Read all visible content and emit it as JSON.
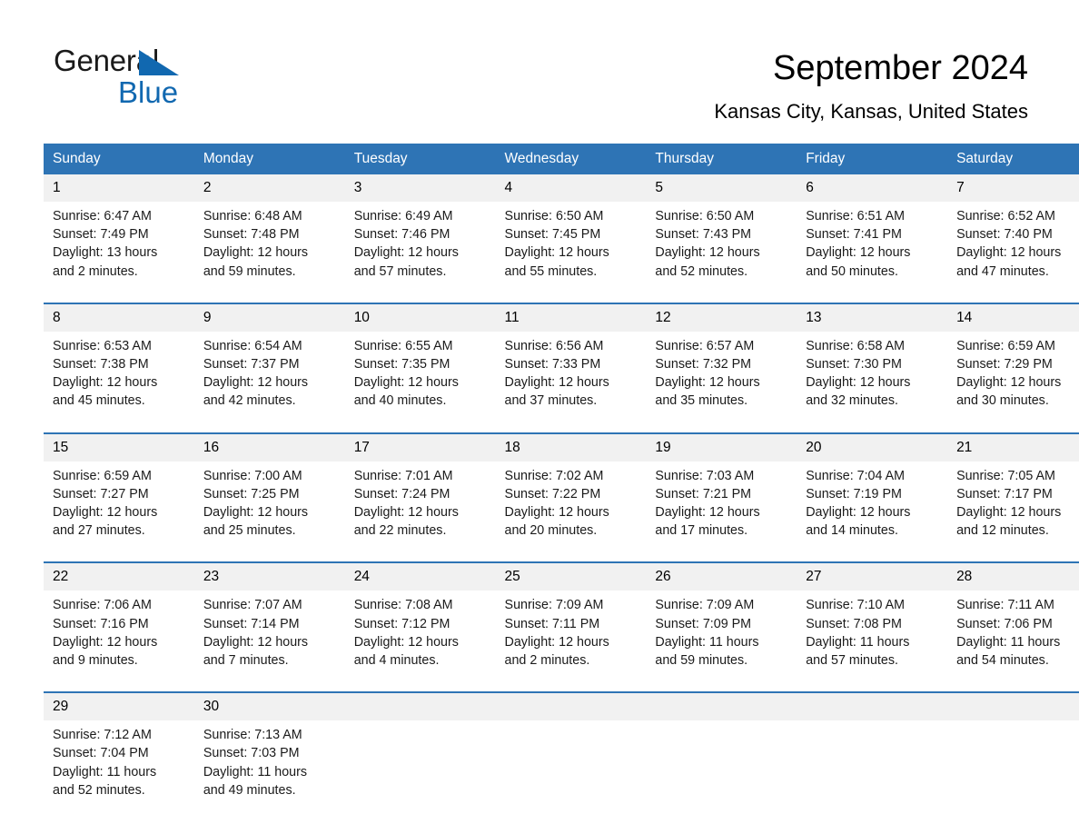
{
  "brand": {
    "line1": "General",
    "line2": "Blue",
    "accent_color": "#1168b0"
  },
  "header": {
    "title": "September 2024",
    "subtitle": "Kansas City, Kansas, United States"
  },
  "theme": {
    "header_blue": "#2e74b5",
    "daynum_band": "#f1f1f1",
    "text": "#1a1a1a"
  },
  "weekday_headers": [
    "Sunday",
    "Monday",
    "Tuesday",
    "Wednesday",
    "Thursday",
    "Friday",
    "Saturday"
  ],
  "weeks": [
    {
      "days": [
        {
          "num": "1",
          "sunrise": "Sunrise: 6:47 AM",
          "sunset": "Sunset: 7:49 PM",
          "daylight_1": "Daylight: 13 hours",
          "daylight_2": "and 2 minutes."
        },
        {
          "num": "2",
          "sunrise": "Sunrise: 6:48 AM",
          "sunset": "Sunset: 7:48 PM",
          "daylight_1": "Daylight: 12 hours",
          "daylight_2": "and 59 minutes."
        },
        {
          "num": "3",
          "sunrise": "Sunrise: 6:49 AM",
          "sunset": "Sunset: 7:46 PM",
          "daylight_1": "Daylight: 12 hours",
          "daylight_2": "and 57 minutes."
        },
        {
          "num": "4",
          "sunrise": "Sunrise: 6:50 AM",
          "sunset": "Sunset: 7:45 PM",
          "daylight_1": "Daylight: 12 hours",
          "daylight_2": "and 55 minutes."
        },
        {
          "num": "5",
          "sunrise": "Sunrise: 6:50 AM",
          "sunset": "Sunset: 7:43 PM",
          "daylight_1": "Daylight: 12 hours",
          "daylight_2": "and 52 minutes."
        },
        {
          "num": "6",
          "sunrise": "Sunrise: 6:51 AM",
          "sunset": "Sunset: 7:41 PM",
          "daylight_1": "Daylight: 12 hours",
          "daylight_2": "and 50 minutes."
        },
        {
          "num": "7",
          "sunrise": "Sunrise: 6:52 AM",
          "sunset": "Sunset: 7:40 PM",
          "daylight_1": "Daylight: 12 hours",
          "daylight_2": "and 47 minutes."
        }
      ]
    },
    {
      "days": [
        {
          "num": "8",
          "sunrise": "Sunrise: 6:53 AM",
          "sunset": "Sunset: 7:38 PM",
          "daylight_1": "Daylight: 12 hours",
          "daylight_2": "and 45 minutes."
        },
        {
          "num": "9",
          "sunrise": "Sunrise: 6:54 AM",
          "sunset": "Sunset: 7:37 PM",
          "daylight_1": "Daylight: 12 hours",
          "daylight_2": "and 42 minutes."
        },
        {
          "num": "10",
          "sunrise": "Sunrise: 6:55 AM",
          "sunset": "Sunset: 7:35 PM",
          "daylight_1": "Daylight: 12 hours",
          "daylight_2": "and 40 minutes."
        },
        {
          "num": "11",
          "sunrise": "Sunrise: 6:56 AM",
          "sunset": "Sunset: 7:33 PM",
          "daylight_1": "Daylight: 12 hours",
          "daylight_2": "and 37 minutes."
        },
        {
          "num": "12",
          "sunrise": "Sunrise: 6:57 AM",
          "sunset": "Sunset: 7:32 PM",
          "daylight_1": "Daylight: 12 hours",
          "daylight_2": "and 35 minutes."
        },
        {
          "num": "13",
          "sunrise": "Sunrise: 6:58 AM",
          "sunset": "Sunset: 7:30 PM",
          "daylight_1": "Daylight: 12 hours",
          "daylight_2": "and 32 minutes."
        },
        {
          "num": "14",
          "sunrise": "Sunrise: 6:59 AM",
          "sunset": "Sunset: 7:29 PM",
          "daylight_1": "Daylight: 12 hours",
          "daylight_2": "and 30 minutes."
        }
      ]
    },
    {
      "days": [
        {
          "num": "15",
          "sunrise": "Sunrise: 6:59 AM",
          "sunset": "Sunset: 7:27 PM",
          "daylight_1": "Daylight: 12 hours",
          "daylight_2": "and 27 minutes."
        },
        {
          "num": "16",
          "sunrise": "Sunrise: 7:00 AM",
          "sunset": "Sunset: 7:25 PM",
          "daylight_1": "Daylight: 12 hours",
          "daylight_2": "and 25 minutes."
        },
        {
          "num": "17",
          "sunrise": "Sunrise: 7:01 AM",
          "sunset": "Sunset: 7:24 PM",
          "daylight_1": "Daylight: 12 hours",
          "daylight_2": "and 22 minutes."
        },
        {
          "num": "18",
          "sunrise": "Sunrise: 7:02 AM",
          "sunset": "Sunset: 7:22 PM",
          "daylight_1": "Daylight: 12 hours",
          "daylight_2": "and 20 minutes."
        },
        {
          "num": "19",
          "sunrise": "Sunrise: 7:03 AM",
          "sunset": "Sunset: 7:21 PM",
          "daylight_1": "Daylight: 12 hours",
          "daylight_2": "and 17 minutes."
        },
        {
          "num": "20",
          "sunrise": "Sunrise: 7:04 AM",
          "sunset": "Sunset: 7:19 PM",
          "daylight_1": "Daylight: 12 hours",
          "daylight_2": "and 14 minutes."
        },
        {
          "num": "21",
          "sunrise": "Sunrise: 7:05 AM",
          "sunset": "Sunset: 7:17 PM",
          "daylight_1": "Daylight: 12 hours",
          "daylight_2": "and 12 minutes."
        }
      ]
    },
    {
      "days": [
        {
          "num": "22",
          "sunrise": "Sunrise: 7:06 AM",
          "sunset": "Sunset: 7:16 PM",
          "daylight_1": "Daylight: 12 hours",
          "daylight_2": "and 9 minutes."
        },
        {
          "num": "23",
          "sunrise": "Sunrise: 7:07 AM",
          "sunset": "Sunset: 7:14 PM",
          "daylight_1": "Daylight: 12 hours",
          "daylight_2": "and 7 minutes."
        },
        {
          "num": "24",
          "sunrise": "Sunrise: 7:08 AM",
          "sunset": "Sunset: 7:12 PM",
          "daylight_1": "Daylight: 12 hours",
          "daylight_2": "and 4 minutes."
        },
        {
          "num": "25",
          "sunrise": "Sunrise: 7:09 AM",
          "sunset": "Sunset: 7:11 PM",
          "daylight_1": "Daylight: 12 hours",
          "daylight_2": "and 2 minutes."
        },
        {
          "num": "26",
          "sunrise": "Sunrise: 7:09 AM",
          "sunset": "Sunset: 7:09 PM",
          "daylight_1": "Daylight: 11 hours",
          "daylight_2": "and 59 minutes."
        },
        {
          "num": "27",
          "sunrise": "Sunrise: 7:10 AM",
          "sunset": "Sunset: 7:08 PM",
          "daylight_1": "Daylight: 11 hours",
          "daylight_2": "and 57 minutes."
        },
        {
          "num": "28",
          "sunrise": "Sunrise: 7:11 AM",
          "sunset": "Sunset: 7:06 PM",
          "daylight_1": "Daylight: 11 hours",
          "daylight_2": "and 54 minutes."
        }
      ]
    },
    {
      "days": [
        {
          "num": "29",
          "sunrise": "Sunrise: 7:12 AM",
          "sunset": "Sunset: 7:04 PM",
          "daylight_1": "Daylight: 11 hours",
          "daylight_2": "and 52 minutes."
        },
        {
          "num": "30",
          "sunrise": "Sunrise: 7:13 AM",
          "sunset": "Sunset: 7:03 PM",
          "daylight_1": "Daylight: 11 hours",
          "daylight_2": "and 49 minutes."
        },
        {
          "num": "",
          "sunrise": "",
          "sunset": "",
          "daylight_1": "",
          "daylight_2": ""
        },
        {
          "num": "",
          "sunrise": "",
          "sunset": "",
          "daylight_1": "",
          "daylight_2": ""
        },
        {
          "num": "",
          "sunrise": "",
          "sunset": "",
          "daylight_1": "",
          "daylight_2": ""
        },
        {
          "num": "",
          "sunrise": "",
          "sunset": "",
          "daylight_1": "",
          "daylight_2": ""
        },
        {
          "num": "",
          "sunrise": "",
          "sunset": "",
          "daylight_1": "",
          "daylight_2": ""
        }
      ]
    }
  ]
}
